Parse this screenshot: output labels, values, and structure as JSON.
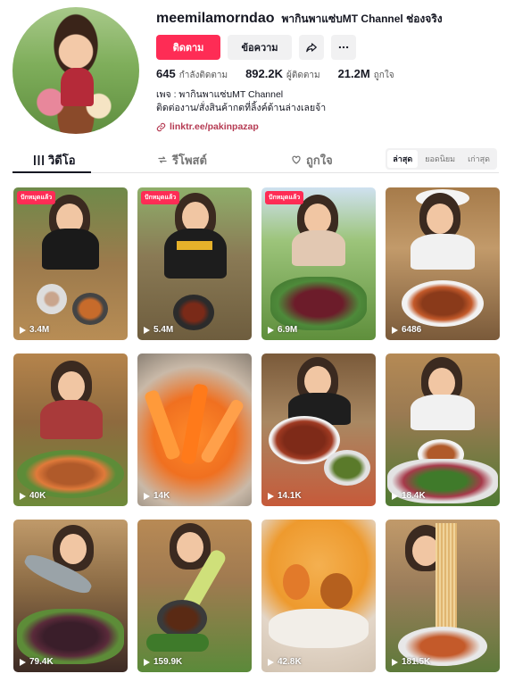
{
  "profile": {
    "username": "meemilamorndao",
    "nickname": "พากินพาแซ่บMT Channel ช่องจริง",
    "follow_label": "ติดตาม",
    "message_label": "ข้อความ",
    "share_icon": "share-icon",
    "more_icon": "more-icon",
    "stats": [
      {
        "value": "645",
        "label": "กำลังติดตาม"
      },
      {
        "value": "892.2K",
        "label": "ผู้ติดตาม"
      },
      {
        "value": "21.2M",
        "label": "ถูกใจ"
      }
    ],
    "bio_line1": "เพจ : พากินพาแซ่บMT Channel",
    "bio_line2": "ติดต่องาน/สั่งสินค้ากดที่ลิ้งค์ด้านล่างเลยจ้า",
    "link": "linktr.ee/pakinpazap"
  },
  "tabs": [
    {
      "label": "วิดีโอ",
      "icon": "grid-icon"
    },
    {
      "label": "รีโพสต์",
      "icon": "repost-icon"
    },
    {
      "label": "ถูกใจ",
      "icon": "heart-outline-icon"
    }
  ],
  "sort": [
    "ล่าสุด",
    "ยอดนิยม",
    "เก่าสุด"
  ],
  "colors": {
    "accent": "#fe2c55",
    "link": "#b53a52",
    "text": "#161823"
  },
  "videos": [
    {
      "views": "3.4M",
      "badge": "ปักหมุดแล้ว"
    },
    {
      "views": "5.4M",
      "badge": "ปักหมุดแล้ว"
    },
    {
      "views": "6.9M",
      "badge": "ปักหมุดแล้ว"
    },
    {
      "views": "6486",
      "badge": null
    },
    {
      "views": "40K",
      "badge": null
    },
    {
      "views": "14K",
      "badge": null
    },
    {
      "views": "14.1K",
      "badge": null
    },
    {
      "views": "18.4K",
      "badge": null
    },
    {
      "views": "79.4K",
      "badge": null
    },
    {
      "views": "159.9K",
      "badge": null
    },
    {
      "views": "42.8K",
      "badge": null
    },
    {
      "views": "181.5K",
      "badge": null
    }
  ]
}
